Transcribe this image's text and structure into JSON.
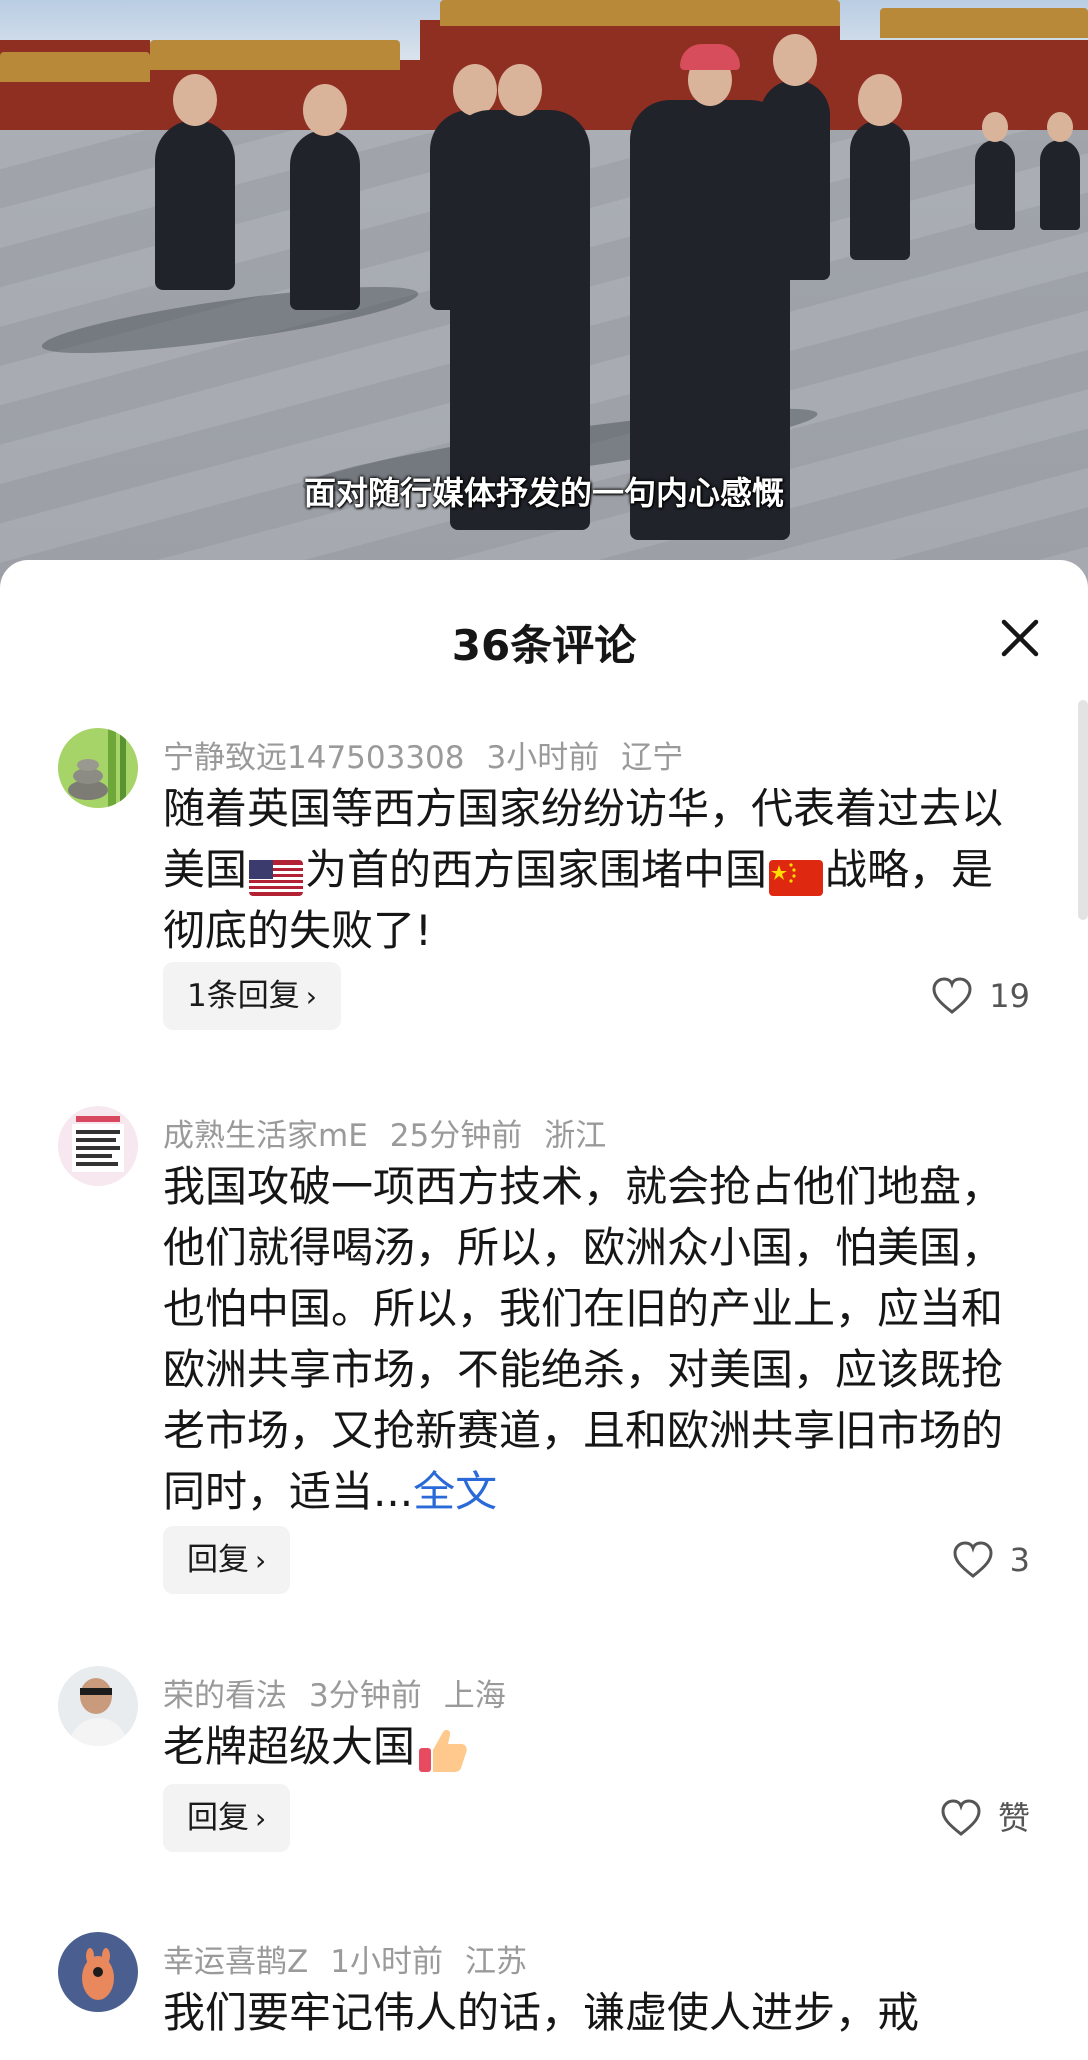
{
  "video": {
    "subtitle": "面对随行媒体抒发的一句内心感慨"
  },
  "sheet": {
    "title": "36条评论"
  },
  "comments": [
    {
      "username": "宁静致远147503308",
      "time": "3小时前",
      "location": "辽宁",
      "text_parts": [
        "随着英国等西方国家纷纷访华，代表着过去以美国",
        "为首的西方国家围堵中国",
        "战略，是彻底的失败了!"
      ],
      "emoji": [
        "us-flag-icon",
        "china-flag-icon"
      ],
      "reply_label": "1条回复",
      "likes": "19"
    },
    {
      "username": "成熟生活家mE",
      "time": "25分钟前",
      "location": "浙江",
      "text": "我国攻破一项西方技术，就会抢占他们地盘，他们就得喝汤，所以，欧洲众小国，怕美国，也怕中国。所以，我们在旧的产业上，应当和欧洲共享市场，不能绝杀，对美国，应该既抢老市场，又抢新赛道，且和欧洲共享旧市场的同时，适当...",
      "more_label": "全文",
      "reply_label": "回复",
      "likes": "3"
    },
    {
      "username": "荣的看法",
      "time": "3分钟前",
      "location": "上海",
      "text": "老牌超级大国",
      "emoji": [
        "thumbs-up-icon"
      ],
      "reply_label": "回复",
      "likes": "赞"
    },
    {
      "username": "幸运喜鹊Z",
      "time": "1小时前",
      "location": "江苏",
      "text": "我们要牢记伟人的话，谦虚使人进步，戒"
    }
  ],
  "colors": {
    "accent_link": "#2a6ad8",
    "meta_gray": "#9a9a9a",
    "button_bg": "#f3f3f3"
  }
}
